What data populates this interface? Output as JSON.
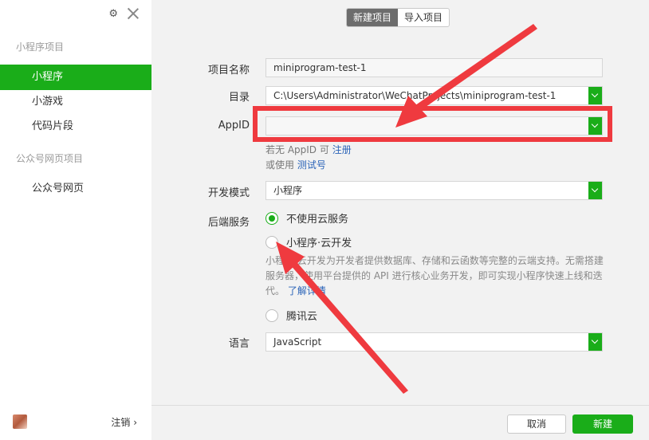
{
  "sidebar": {
    "sections": [
      "小程序项目",
      "公众号网页项目"
    ],
    "items": [
      {
        "label": "小程序"
      },
      {
        "label": "小游戏"
      },
      {
        "label": "代码片段"
      },
      {
        "label": "公众号网页"
      }
    ],
    "logout_label": "注销 ›"
  },
  "tabs": [
    {
      "label": "新建项目"
    },
    {
      "label": "导入项目"
    }
  ],
  "form": {
    "name_label": "项目名称",
    "name_value": "miniprogram-test-1",
    "dir_label": "目录",
    "dir_value": "C:\\Users\\Administrator\\WeChatProjects\\miniprogram-test-1",
    "appid_label": "AppID",
    "appid_value": "",
    "appid_hint_prefix": "若无 AppID 可",
    "appid_hint_link": "注册",
    "appid_hint2_prefix": "或使用",
    "appid_hint2_link": "测试号",
    "mode_label": "开发模式",
    "mode_value": "小程序",
    "backend_label": "后端服务",
    "backend_options": [
      {
        "label": "不使用云服务",
        "checked": true
      },
      {
        "label": "小程序·云开发",
        "checked": false
      },
      {
        "label": "腾讯云",
        "checked": false
      }
    ],
    "cloud_desc": "小程序·云开发为开发者提供数据库、存储和云函数等完整的云端支持。无需搭建服务器，使用平台提供的 API 进行核心业务开发，即可实现小程序快速上线和迭代。",
    "cloud_desc_link": "了解详情",
    "lang_label": "语言",
    "lang_value": "JavaScript"
  },
  "footer": {
    "cancel_label": "取消",
    "create_label": "新建"
  },
  "colors": {
    "accent": "#1aad19",
    "annotation": "#ef3a3f",
    "link": "#2b64b8"
  }
}
